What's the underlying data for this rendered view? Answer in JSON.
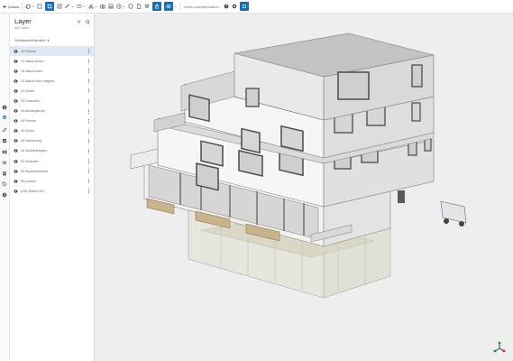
{
  "toolbar": {
    "back_label": "Zurück",
    "link_text": "bimfo.com/derivative"
  },
  "panel": {
    "title": "Layer",
    "subtitle": "Alle Layer",
    "sort_label": "Sichtbarkeit ändern"
  },
  "layers": [
    {
      "label": "10 Räume",
      "selected": true
    },
    {
      "label": "10 Wand außen"
    },
    {
      "label": "10 Wand innen"
    },
    {
      "label": "10 Wand innen tragend"
    },
    {
      "label": "20 Decke"
    },
    {
      "label": "30 Dachdach"
    },
    {
      "label": "40 Abhangdecke"
    },
    {
      "label": "40 Fenster"
    },
    {
      "label": "40 Küche"
    },
    {
      "label": "40 Möblierung"
    },
    {
      "label": "40 Sanitäranlagen"
    },
    {
      "label": "50 Geländer"
    },
    {
      "label": "60 Baukörperkante"
    },
    {
      "label": "60 Achsen"
    },
    {
      "label": "IU50 Raster 001"
    }
  ],
  "colors": {
    "accent": "#1a6fb3",
    "selected_row": "#dfe9f5",
    "viewport_bg": "#eeeeee"
  }
}
